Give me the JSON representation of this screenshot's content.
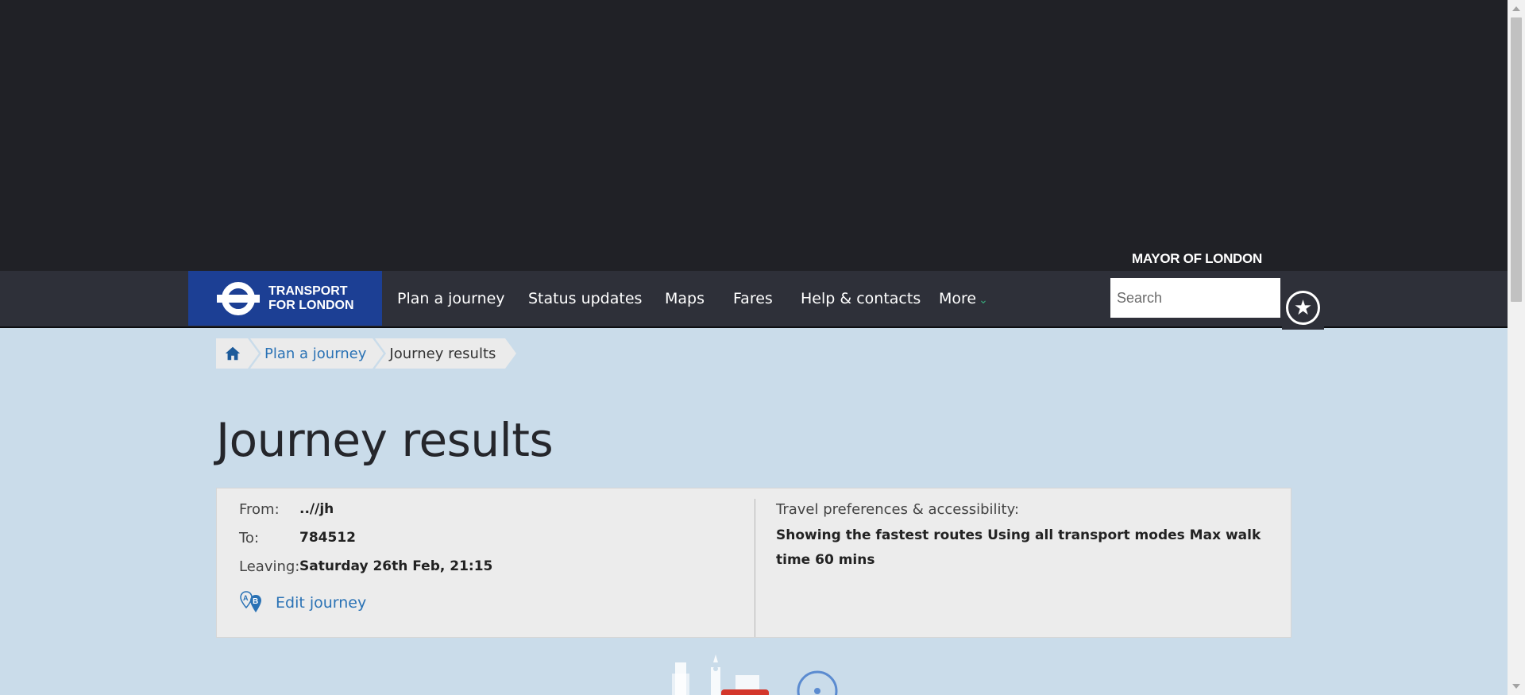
{
  "header": {
    "mayor": "MAYOR OF LONDON",
    "logo_line1": "TRANSPORT",
    "logo_line2": "FOR LONDON"
  },
  "nav": {
    "items": [
      {
        "label": "Plan a journey"
      },
      {
        "label": "Status updates"
      },
      {
        "label": "Maps"
      },
      {
        "label": "Fares"
      },
      {
        "label": "Help & contacts"
      },
      {
        "label": "More"
      }
    ],
    "search_placeholder": "Search"
  },
  "breadcrumb": {
    "items": [
      {
        "label": "Plan a journey"
      },
      {
        "label": "Journey results"
      }
    ]
  },
  "page": {
    "title": "Journey results"
  },
  "summary": {
    "from_label": "From:",
    "from_value": "..//jh",
    "to_label": "To:",
    "to_value": "784512",
    "leaving_label": "Leaving:",
    "leaving_value": "Saturday 26th Feb, 21:15",
    "edit_label": "Edit journey",
    "prefs_label": "Travel preferences & accessibility:",
    "prefs_value": "Showing the fastest routes Using all transport modes Max walk time 60 mins"
  },
  "colors": {
    "brand_blue": "#1c3f94",
    "link_blue": "#2a72b5",
    "page_bg": "#cadcea",
    "nav_bg": "#2e3039",
    "dark_bg": "#202126"
  },
  "icons": {
    "home": "home-icon",
    "favourite": "star-icon",
    "edit": "map-pin-ab-icon",
    "more": "chevron-down-icon"
  }
}
